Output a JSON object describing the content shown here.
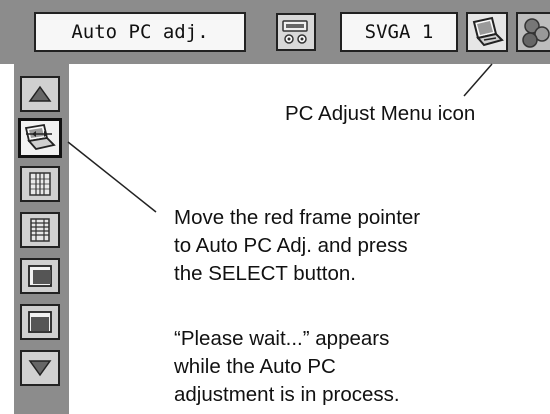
{
  "top_menu": {
    "selected_item_label": "Auto PC adj.",
    "mode_label": "SVGA 1",
    "icons": [
      "input-source-icon",
      "pc-adjust-menu-icon",
      "next-menu-icon"
    ]
  },
  "side_menu": {
    "items": [
      {
        "icon": "scroll-up-arrow-icon"
      },
      {
        "icon": "auto-pc-adj-icon",
        "selected": true
      },
      {
        "icon": "fine-sync-icon"
      },
      {
        "icon": "total-dots-icon"
      },
      {
        "icon": "horizontal-position-icon"
      },
      {
        "icon": "vertical-position-icon"
      },
      {
        "icon": "scroll-down-arrow-icon"
      }
    ]
  },
  "annotations": {
    "menu_icon_label": "PC Adjust Menu icon",
    "instruction_line_1": "Move the red frame pointer",
    "instruction_line_2": "to Auto PC Adj. and press",
    "instruction_line_3": "the SELECT button.",
    "wait_line_1": "“Please wait...” appears",
    "wait_line_2": "while the Auto PC",
    "wait_line_3": "adjustment is in process."
  }
}
